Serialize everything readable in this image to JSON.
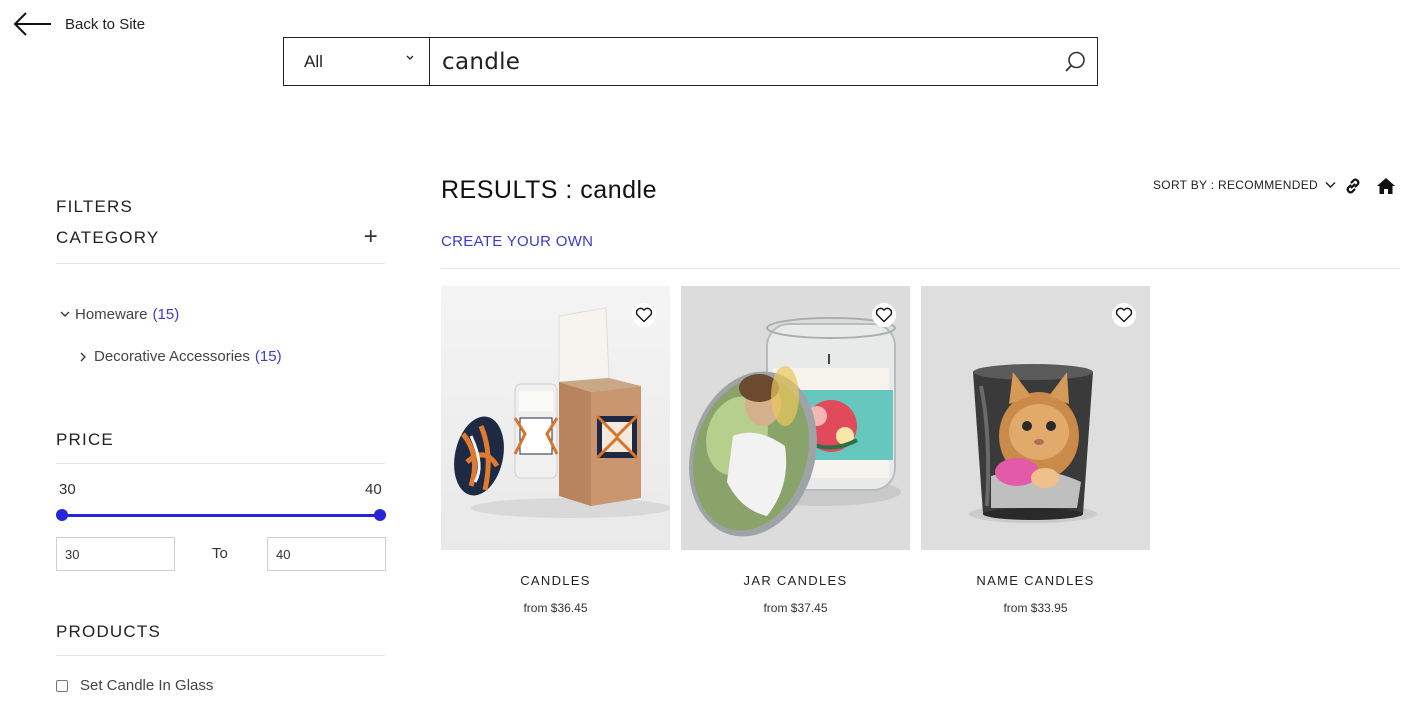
{
  "nav": {
    "back_label": "Back to Site"
  },
  "search": {
    "scope": "All",
    "query": "candle"
  },
  "filters": {
    "title": "FILTERS",
    "category": {
      "title": "CATEGORY",
      "items": [
        {
          "label": "Homeware",
          "count": "(15)"
        },
        {
          "label": "Decorative Accessories",
          "count": "(15)"
        }
      ]
    },
    "price": {
      "title": "PRICE",
      "min_label": "30",
      "max_label": "40",
      "min_value": "30",
      "max_value": "40",
      "to_label": "To",
      "selected_range": [
        30,
        40
      ]
    },
    "products": {
      "title": "PRODUCTS",
      "items": [
        {
          "label": "Set Candle In Glass",
          "checked": false
        }
      ]
    }
  },
  "results": {
    "title_prefix": "RESULTS :",
    "query": "candle",
    "sort_label": "SORT BY : RECOMMENDED",
    "create_link": "CREATE YOUR OWN",
    "products": [
      {
        "name": "CANDLES",
        "price": "from $36.45"
      },
      {
        "name": "JAR CANDLES",
        "price": "from $37.45"
      },
      {
        "name": "NAME CANDLES",
        "price": "from $33.95"
      }
    ]
  },
  "colors": {
    "accent": "#2626d9",
    "link": "#3b3bd0"
  },
  "icons": [
    "arrow-left-icon",
    "chevron-down-icon",
    "search-icon",
    "plus-icon",
    "link-icon",
    "home-icon",
    "heart-icon"
  ]
}
